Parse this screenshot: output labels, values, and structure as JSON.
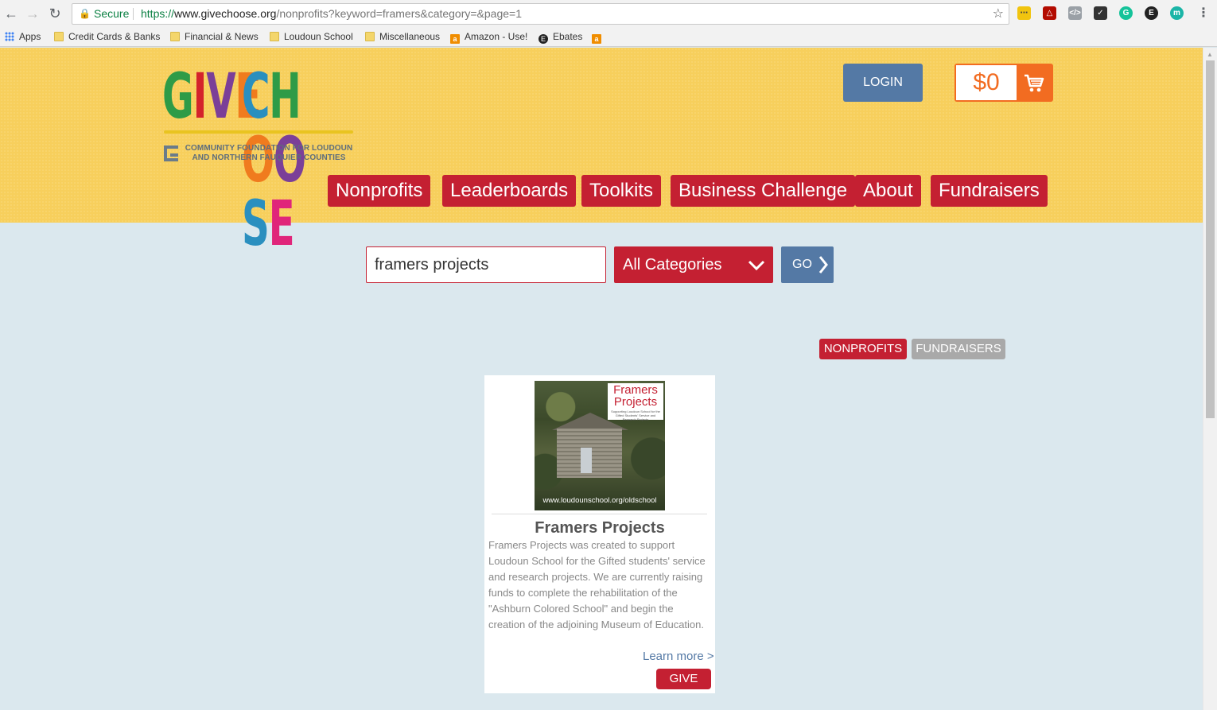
{
  "browser": {
    "secure_label": "Secure",
    "url_scheme": "https://",
    "url_host": "www.givechoose.org",
    "url_path": "/nonprofits?keyword=framers&category=&page=1",
    "bookmarks": [
      "Apps",
      "Credit Cards & Banks",
      "Financial & News",
      "Loudoun School",
      "Miscellaneous",
      "Amazon - Use!",
      "Ebates"
    ]
  },
  "header": {
    "logo_word1": "GIVE",
    "logo_word2": "CHOOSE",
    "logo_tagline": "COMMUNITY FOUNDATION FOR LOUDOUN AND NORTHERN FAUQUIER COUNTIES",
    "login_label": "LOGIN",
    "cart_amount": "$0",
    "nav": [
      "Nonprofits",
      "Leaderboards",
      "Toolkits",
      "Business Challenge",
      "About",
      "Fundraisers"
    ]
  },
  "search": {
    "keyword": "framers projects",
    "category": "All Categories",
    "go_label": "GO"
  },
  "tabs": {
    "nonprofits": "NONPROFITS",
    "fundraisers": "FUNDRAISERS"
  },
  "result": {
    "image_title": "Framers Projects",
    "image_subtitle": "Supporting Loudoun School for the Gifted Students' Service and Research Projects",
    "image_url": "www.loudounschool.org/oldschool",
    "title": "Framers Projects",
    "description": "Framers Projects was created to support Loudoun School for the Gifted students' service and research projects. We are currently raising funds to complete the rehabilitation of the \"Ashburn Colored School\" and begin the creation of the adjoining Museum of Education.",
    "learn_more": "Learn more >",
    "give_label": "GIVE"
  },
  "colors": {
    "header_bg": "#f7cf5c",
    "nav_red": "#c42032",
    "button_blue": "#5479a5",
    "cart_orange": "#f26c21",
    "page_bg": "#dbe8ee"
  }
}
